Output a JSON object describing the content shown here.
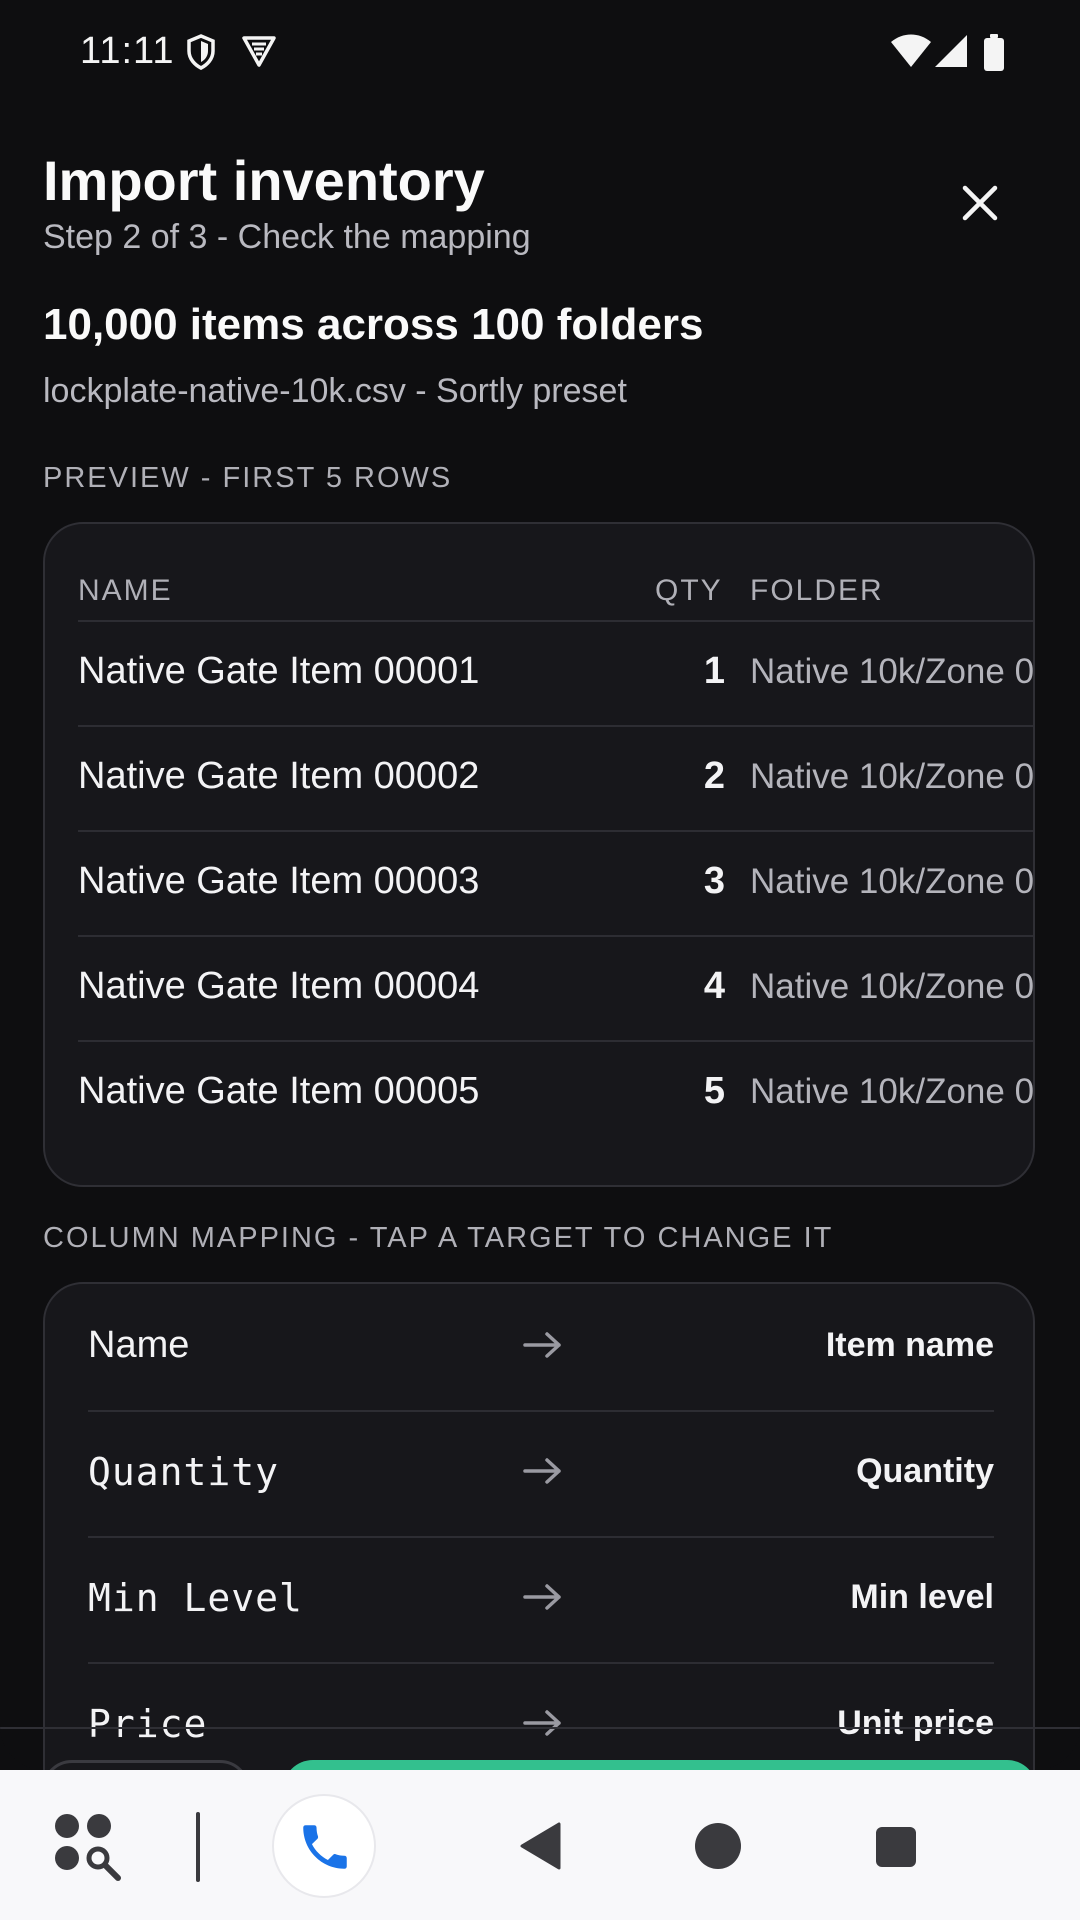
{
  "status_bar": {
    "time": "11:11",
    "left_icons": [
      "shield-icon",
      "vpn-icon"
    ],
    "right_icons": [
      "wifi-icon",
      "signal-icon",
      "battery-icon"
    ]
  },
  "header": {
    "title": "Import inventory",
    "subtitle": "Step 2 of 3 - Check the mapping",
    "close_icon": "close-icon"
  },
  "summary": {
    "title": "10,000 items across 100 folders",
    "file": "lockplate-native-10k.csv - Sortly preset"
  },
  "preview": {
    "label": "PREVIEW - FIRST 5 ROWS",
    "columns": {
      "name": "NAME",
      "qty": "QTY",
      "folder": "FOLDER"
    },
    "rows": [
      {
        "name": "Native Gate Item 00001",
        "qty": "1",
        "folder": "Native 10k/Zone 0"
      },
      {
        "name": "Native Gate Item 00002",
        "qty": "2",
        "folder": "Native 10k/Zone 0"
      },
      {
        "name": "Native Gate Item 00003",
        "qty": "3",
        "folder": "Native 10k/Zone 0"
      },
      {
        "name": "Native Gate Item 00004",
        "qty": "4",
        "folder": "Native 10k/Zone 0"
      },
      {
        "name": "Native Gate Item 00005",
        "qty": "5",
        "folder": "Native 10k/Zone 0"
      }
    ]
  },
  "mapping": {
    "label": "COLUMN MAPPING - TAP A TARGET TO CHANGE IT",
    "rows": [
      {
        "source": "Name",
        "target": "Item name"
      },
      {
        "source": "Quantity",
        "target": "Quantity"
      },
      {
        "source": "Min Level",
        "target": "Min level"
      },
      {
        "source": "Price",
        "target": "Unit price"
      }
    ]
  },
  "nav_bar": {
    "icons": [
      "app-drawer-search-icon",
      "phone-icon",
      "back-icon",
      "home-icon",
      "recents-icon"
    ]
  },
  "colors": {
    "background": "#0e0e10",
    "card": "#17171b",
    "accent": "#33c08e",
    "phone_blue": "#1a73e8"
  }
}
